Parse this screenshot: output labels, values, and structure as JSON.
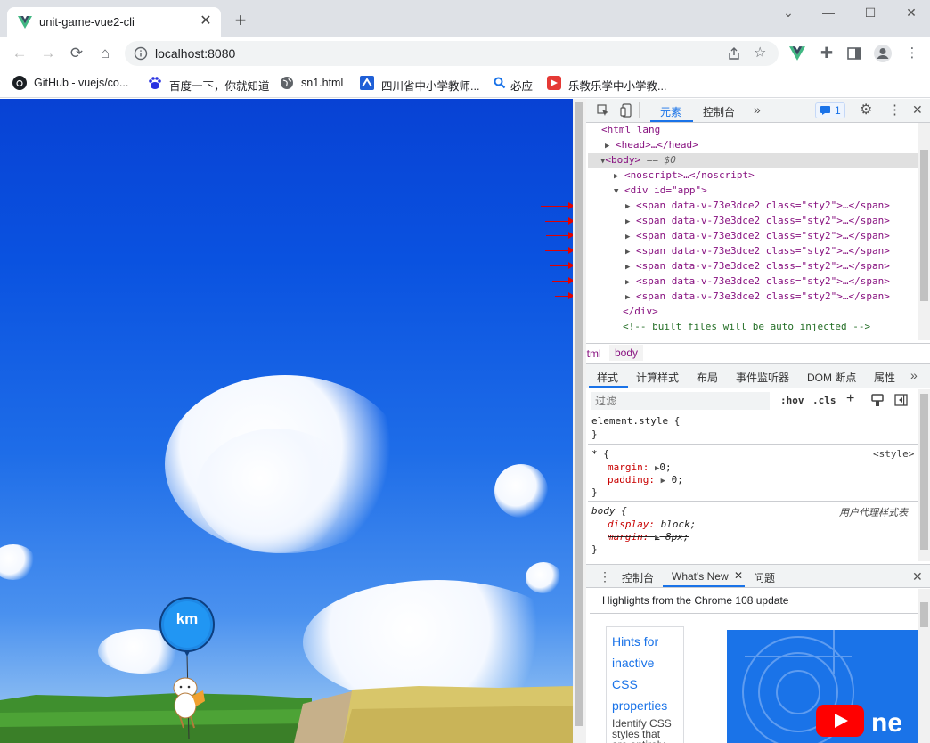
{
  "browser": {
    "tab_title": "unit-game-vue2-cli",
    "tab_close": "✕",
    "new_tab": "+",
    "url": "localhost:8080",
    "window_controls": {
      "minimize": "⌄",
      "restore": "—",
      "maximize": "☐",
      "close": "✕"
    }
  },
  "bookmarks": [
    {
      "label": "GitHub - vuejs/co...",
      "icon": "github-icon"
    },
    {
      "label": "百度一下，你就知道",
      "icon": "baidu-icon"
    },
    {
      "label": "sn1.html",
      "icon": "globe-icon"
    },
    {
      "label": "四川省中小学教师...",
      "icon": "edu-icon"
    },
    {
      "label": "必应",
      "icon": "search-icon"
    },
    {
      "label": "乐教乐学中小学教...",
      "icon": "lejiao-icon"
    }
  ],
  "page": {
    "balloon_text": "km"
  },
  "devtools": {
    "tabs": [
      "元素",
      "控制台"
    ],
    "more": "»",
    "issues_count": "1",
    "dom": {
      "html_open": "<html lang",
      "head": "<head>…</head>",
      "body_line": "<body>",
      "body_suffix": "== $0",
      "noscript": "<noscript>…</noscript>",
      "div_open": "<div id=\"app\">",
      "span_rows": [
        "<span data-v-73e3dce2 class=\"sty2\">…</span>",
        "<span data-v-73e3dce2 class=\"sty2\">…</span>",
        "<span data-v-73e3dce2 class=\"sty2\">…</span>",
        "<span data-v-73e3dce2 class=\"sty2\">…</span>",
        "<span data-v-73e3dce2 class=\"sty2\">…</span>",
        "<span data-v-73e3dce2 class=\"sty2\">…</span>",
        "<span data-v-73e3dce2 class=\"sty2\">…</span>"
      ],
      "div_close": "</div>",
      "comment": "<!-- built files will be auto injected -->"
    },
    "breadcrumb": [
      "html",
      "body"
    ],
    "style_tabs": [
      "样式",
      "计算样式",
      "布局",
      "事件监听器",
      "DOM 断点",
      "属性"
    ],
    "filter_placeholder": "过滤",
    "hov": ":hov",
    "cls": ".cls",
    "rules": {
      "element_style": "element.style {",
      "close": "}",
      "star_selector": "* {",
      "star_source": "<style>",
      "margin": "margin:",
      "margin_val": "0;",
      "padding": "padding:",
      "padding_val": "0;",
      "body_selector": "body {",
      "ua_source": "用户代理样式表",
      "display": "display:",
      "display_val": "block;",
      "margin8": "margin:",
      "margin8_val": "8px;"
    },
    "drawer": {
      "tabs": [
        "控制台",
        "What's New",
        "问题"
      ],
      "whatsnew_close": "✕",
      "heading": "Highlights from the Chrome 108 update",
      "card_title": "Hints for inactive CSS properties",
      "card_body": "Identify CSS styles that are entirely",
      "video_text": "ne"
    }
  }
}
